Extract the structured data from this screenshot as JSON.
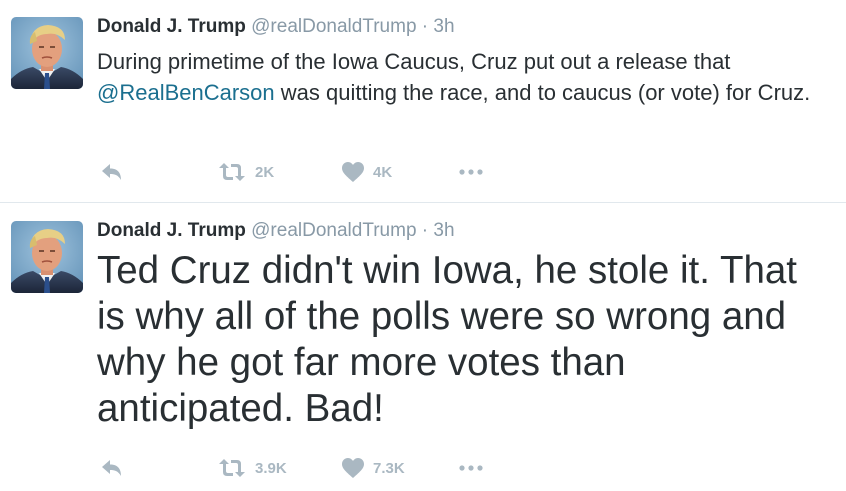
{
  "tweets": [
    {
      "name": "Donald J. Trump",
      "handle": "@realDonaldTrump",
      "separator": "·",
      "time": "3h",
      "text_before": "During primetime of the Iowa Caucus, Cruz put out a release that ",
      "mention": "@RealBenCarson",
      "text_after": " was quitting the race, and to caucus (or vote) for Cruz.",
      "retweets": "2K",
      "likes": "4K"
    },
    {
      "name": "Donald J. Trump",
      "handle": "@realDonaldTrump",
      "separator": "·",
      "time": "3h",
      "text": "Ted Cruz didn't win Iowa, he stole it. That is why all of the polls were so wrong and why he got far more votes than anticipated. Bad!",
      "retweets": "3.9K",
      "likes": "7.3K"
    }
  ],
  "icons": {
    "reply": "reply-icon",
    "retweet": "retweet-icon",
    "like": "heart-icon",
    "more": "more-icon"
  },
  "colors": {
    "text": "#292f33",
    "muted": "#8899a6",
    "action_icon": "#aab8c2",
    "mention": "#1b6f8f"
  }
}
